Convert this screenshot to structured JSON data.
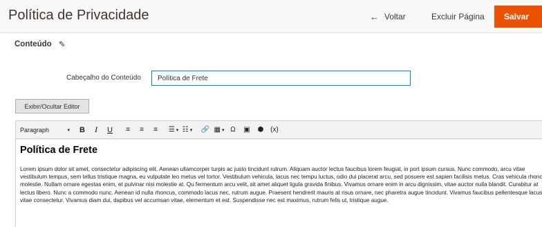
{
  "header": {
    "title": "Política de Privacidade",
    "back_label": "Voltar",
    "back_icon": "←",
    "delete_label": "Excluir Página",
    "save_label": "Salvar"
  },
  "section": {
    "title": "Conteúdo",
    "edit_icon": "✎"
  },
  "form": {
    "heading_label": "Cabeçalho do Conteúdo",
    "heading_value": "Política de Frete"
  },
  "toggle_editor_label": "Exibir/Ocultar Editor",
  "toolbar": {
    "format_label": "Paragraph",
    "bold": "B",
    "italic": "I",
    "underline": "U",
    "align_left": "≡",
    "align_center": "≡",
    "align_right": "≡",
    "bullet_list": "☰",
    "numbered_list": "☷",
    "link": "🔗",
    "table": "▦",
    "special_char": "Ω",
    "image": "▣",
    "widget": "⬢",
    "variable": "(x)",
    "caret": "▾"
  },
  "editor_content": {
    "heading": "Política de Frete",
    "paragraph": "Lorem ipsum dolor sit amet, consectetur adipiscing elit. Aenean ullamcorper turpis ac justo tincidunt rutrum. Aliquam auctor lectus faucibus lorem feugiat, in port ipsum cursus. Nunc commodo, arcu vitae vestibulum tempus, sem tellus tristique magna, eu vulputate leo metus vel tortor. Vestibulum vehicula, lacus nec tempu luctus, odio dui placerat arcu, sed posuere est sapien facilisis metus. Cras vehicula rhoncus molestie. Nullam ornare egestas enim, et pulvinar nisi molestie at. Qu fermentum arcu velit, sit amet aliquet ligula gravida finibus. Vivamus ornare enim in arcu dignissim, vitae auctor nulla blandit. Curabitur at lectus libero. Nunc a commodo nunc. Aenean id nulla rhoncus, commodo lacus nec, rutrum augue. Praesent hendrerit mauris at risus ornare, nec pharetra augue tincidunt. Vivamus faucibus pellentesque lacus vitae consectetur. Vivamus diam dui, dapibus vel accumsan vitae, elementum et est. Suspendisse nec est maximus, rutrum felis ut, tristique augue."
  }
}
